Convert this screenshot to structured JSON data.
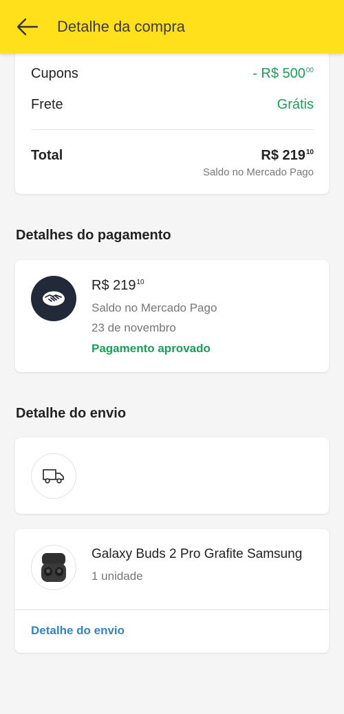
{
  "header": {
    "title": "Detalhe da compra",
    "back_icon": "arrow-left-icon"
  },
  "summary": {
    "coupons": {
      "label": "Cupons",
      "amount_main": "- R$ 500",
      "amount_cents": "00"
    },
    "shipping": {
      "label": "Frete",
      "value": "Grátis"
    },
    "total": {
      "label": "Total",
      "amount_main": "R$ 219",
      "amount_cents": "10",
      "payment_source": "Saldo no Mercado Pago"
    }
  },
  "payment": {
    "section_title": "Detalhes do pagamento",
    "icon": "handshake-icon",
    "amount_main": "R$ 219",
    "amount_cents": "10",
    "method": "Saldo no Mercado Pago",
    "date": "23 de novembro",
    "status": "Pagamento aprovado"
  },
  "shipping": {
    "section_title": "Detalhe do envio",
    "icon": "truck-icon"
  },
  "product": {
    "name": "Galaxy Buds 2 Pro Grafite Samsung",
    "quantity": "1 unidade",
    "link": "Detalhe do envio"
  },
  "colors": {
    "accent_yellow": "#ffe01b",
    "green": "#1a9e57",
    "link_blue": "#3483c9",
    "dark_circle": "#222938"
  }
}
